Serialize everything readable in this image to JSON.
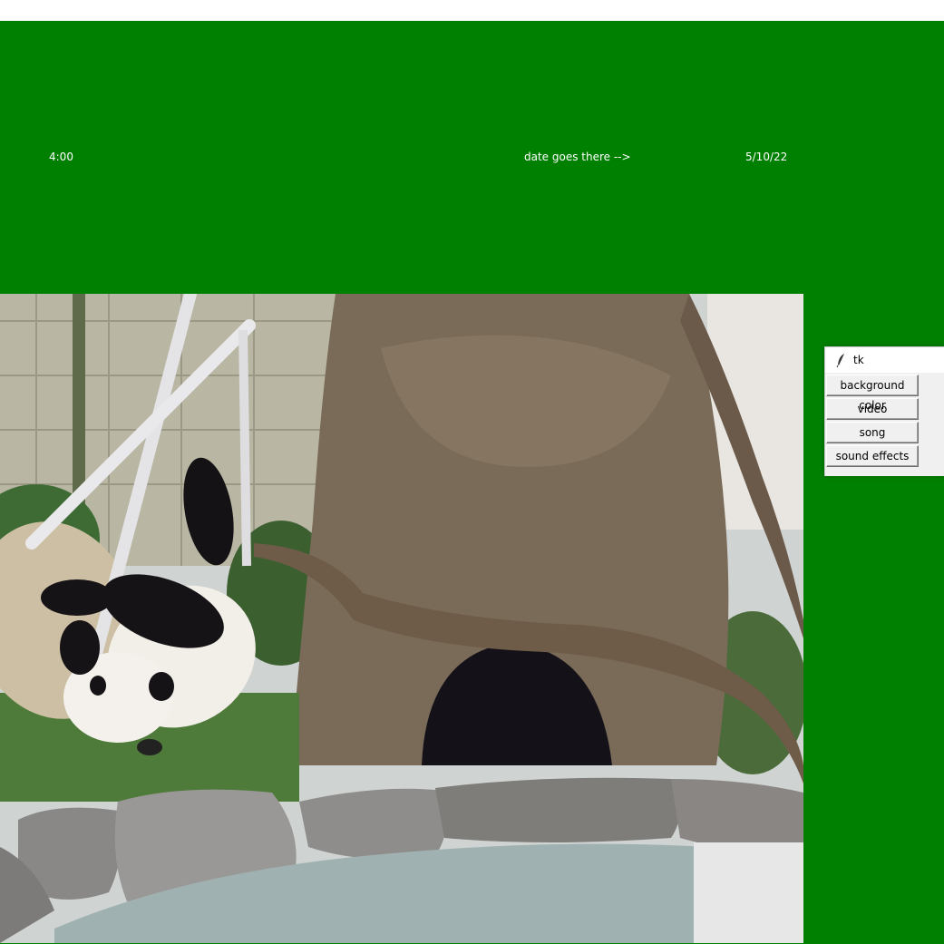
{
  "main_window": {
    "background_color": "#008000",
    "time_label": "4:00",
    "date_hint_label": "date goes there -->",
    "date_label": "5/10/22"
  },
  "video": {
    "subject": "giant panda playing on a swinging disc beside a hollow tree trunk and a pond"
  },
  "tk_window": {
    "title": "tk",
    "icon": "feather-icon",
    "buttons": [
      "background color",
      "video",
      "song",
      "sound effects"
    ]
  }
}
